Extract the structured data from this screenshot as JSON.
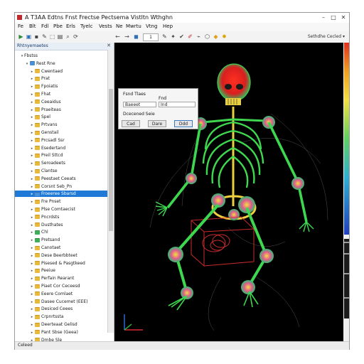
{
  "window": {
    "title": "A T3AA Edtns Fnst Frectse Pectsema Vistltn Wthghn",
    "controls": {
      "minimize": "–",
      "maximize": "□",
      "close": "✕"
    }
  },
  "menu": [
    "Fe",
    "Blt",
    "Fdl",
    "Pbe",
    "Erls",
    "Tyelc",
    "Vests",
    "Ne",
    "Mwrtu",
    "Vtng",
    "Hep"
  ],
  "toolbar": {
    "field_value": "1",
    "right_label": "Sethdhe Cecled",
    "right_arrow": "▾",
    "icons": [
      {
        "name": "new-icon",
        "glyph": "▶",
        "color": "#2c8a3a"
      },
      {
        "name": "open-icon",
        "glyph": "▣",
        "color": "#2f6fb3"
      },
      {
        "name": "save-icon",
        "glyph": "▪",
        "color": "#444"
      },
      {
        "name": "edit-icon",
        "glyph": "✎",
        "color": "#444"
      },
      {
        "name": "select-icon",
        "glyph": "⬚",
        "color": "#444"
      },
      {
        "name": "document-icon",
        "glyph": "▤",
        "color": "#444"
      },
      {
        "name": "zoom-icon",
        "glyph": "⌕",
        "color": "#444"
      },
      {
        "name": "rotate-icon",
        "glyph": "⟳",
        "color": "#444"
      },
      {
        "name": "back-icon",
        "glyph": "←",
        "color": "#444"
      },
      {
        "name": "forward-icon",
        "glyph": "→",
        "color": "#444"
      },
      {
        "name": "camera-icon",
        "glyph": "◼",
        "color": "#2f6fb3"
      },
      {
        "name": "brush-icon",
        "glyph": "✎",
        "color": "#444"
      },
      {
        "name": "pick-icon",
        "glyph": "✦",
        "color": "#444"
      },
      {
        "name": "check-icon",
        "glyph": "✔",
        "color": "#444"
      },
      {
        "name": "pen-icon",
        "glyph": "✐",
        "color": "#c0282d"
      },
      {
        "name": "wand-icon",
        "glyph": "⌁",
        "color": "#444"
      },
      {
        "name": "cube-icon",
        "glyph": "⬡",
        "color": "#444"
      },
      {
        "name": "cone-icon",
        "glyph": "◆",
        "color": "#e0a020"
      },
      {
        "name": "light-icon",
        "glyph": "✹",
        "color": "#d9a400"
      }
    ]
  },
  "sidebar": {
    "title": "Rhtnyemaetes",
    "close_glyph": "✕",
    "items": [
      {
        "depth": 2,
        "label": "Fbstss",
        "icon": "none",
        "twisty": "▾"
      },
      {
        "depth": 3,
        "label": "Rest Rne",
        "icon": "blue",
        "twisty": "▾"
      },
      {
        "depth": 4,
        "label": "Cwentaed",
        "icon": "folder",
        "twisty": "▸"
      },
      {
        "depth": 4,
        "label": "Prat",
        "icon": "folder",
        "twisty": "▸"
      },
      {
        "depth": 4,
        "label": "Fpoiatis",
        "icon": "folder",
        "twisty": "▸"
      },
      {
        "depth": 4,
        "label": "Fhat",
        "icon": "folder",
        "twisty": "▸"
      },
      {
        "depth": 4,
        "label": "Ceeaidus",
        "icon": "folder",
        "twisty": "▸"
      },
      {
        "depth": 4,
        "label": "Praeiteas",
        "icon": "folder",
        "twisty": "▸"
      },
      {
        "depth": 4,
        "label": "Spel",
        "icon": "folder",
        "twisty": "▸"
      },
      {
        "depth": 4,
        "label": "Prtvans",
        "icon": "folder",
        "twisty": "▸"
      },
      {
        "depth": 4,
        "label": "Genstail",
        "icon": "folder",
        "twisty": "▸"
      },
      {
        "depth": 4,
        "label": "Prcsadl Ssr",
        "icon": "folder",
        "twisty": "▸"
      },
      {
        "depth": 4,
        "label": "Esedertand",
        "icon": "folder",
        "twisty": "▸"
      },
      {
        "depth": 4,
        "label": "Preil Sttcd",
        "icon": "folder",
        "twisty": "▸"
      },
      {
        "depth": 4,
        "label": "Seroadeets",
        "icon": "folder",
        "twisty": "▸"
      },
      {
        "depth": 4,
        "label": "Clantse",
        "icon": "folder",
        "twisty": "▸"
      },
      {
        "depth": 4,
        "label": "Peestaet Ceeats",
        "icon": "folder",
        "twisty": "▸"
      },
      {
        "depth": 4,
        "label": "Corsnt Seb_Pn",
        "icon": "folder",
        "twisty": "▸"
      },
      {
        "depth": 4,
        "label": "Froeeree Sbarsd",
        "icon": "blue",
        "twisty": "▸",
        "selected": true
      },
      {
        "depth": 4,
        "label": "Fre Pnset",
        "icon": "folder",
        "twisty": "▸"
      },
      {
        "depth": 4,
        "label": "Plse Comtaecist",
        "icon": "folder",
        "twisty": "▸"
      },
      {
        "depth": 4,
        "label": "Pncrdsts",
        "icon": "folder",
        "twisty": "▸"
      },
      {
        "depth": 4,
        "label": "Dusthates",
        "icon": "folder",
        "twisty": "▸"
      },
      {
        "depth": 4,
        "label": "Chl",
        "icon": "green",
        "twisty": "▸"
      },
      {
        "depth": 4,
        "label": "Pretsand",
        "icon": "green",
        "twisty": "▸"
      },
      {
        "depth": 4,
        "label": "Canotaet",
        "icon": "folder",
        "twisty": "▸"
      },
      {
        "depth": 4,
        "label": "Dese Beerbbteet",
        "icon": "folder",
        "twisty": "▸"
      },
      {
        "depth": 4,
        "label": "Pisesed & Pasgtkeed",
        "icon": "folder",
        "twisty": "▸"
      },
      {
        "depth": 4,
        "label": "Peeiue",
        "icon": "folder",
        "twisty": "▸"
      },
      {
        "depth": 4,
        "label": "Perfain Rearant",
        "icon": "folder",
        "twisty": "▸"
      },
      {
        "depth": 4,
        "label": "Piaet Cor Ceceesd",
        "icon": "folder",
        "twisty": "▸"
      },
      {
        "depth": 4,
        "label": "Eeere Comlaet",
        "icon": "folder",
        "twisty": "▸"
      },
      {
        "depth": 4,
        "label": "Dasee Cucemet (EEE)",
        "icon": "folder",
        "twisty": "▸"
      },
      {
        "depth": 4,
        "label": "Desiced Ceees",
        "icon": "folder",
        "twisty": "▸"
      },
      {
        "depth": 4,
        "label": "Crpnrtssta",
        "icon": "folder",
        "twisty": "▸"
      },
      {
        "depth": 4,
        "label": "Deerteaat Gelisd",
        "icon": "folder",
        "twisty": "▸"
      },
      {
        "depth": 4,
        "label": "Pant Sbse (Geea)",
        "icon": "folder",
        "twisty": "▸"
      },
      {
        "depth": 4,
        "label": "Dmbe Sle",
        "icon": "folder",
        "twisty": "▸"
      }
    ]
  },
  "dialog": {
    "label_left": "Fsnd Tlaes",
    "label_right": "Fnd",
    "field_left": "Baeeet",
    "field_right": "Ind",
    "caption": "Dcecened Seie",
    "buttons": [
      "Cad",
      "Dare",
      "Ddd"
    ]
  },
  "status": {
    "text": "Celeed"
  },
  "colors": {
    "accent": "#1e7ad6",
    "viewport_bg": "#000000",
    "bone_green": "#38d848",
    "bone_red": "#e03020",
    "bone_yellow": "#f0d040"
  }
}
